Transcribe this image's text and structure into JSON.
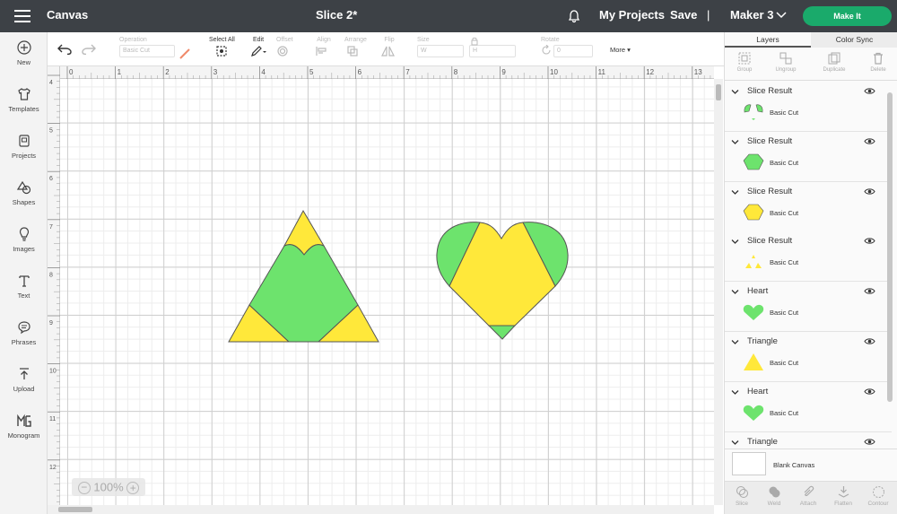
{
  "topbar": {
    "app_title": "Canvas",
    "document_title": "Slice 2*",
    "my_projects": "My Projects",
    "save": "Save",
    "separator": "|",
    "machine": "Maker 3",
    "make_it": "Make It"
  },
  "sidebar": {
    "items": [
      {
        "label": "New",
        "icon": "plus-circle-icon"
      },
      {
        "label": "Templates",
        "icon": "shirt-icon"
      },
      {
        "label": "Projects",
        "icon": "projects-icon"
      },
      {
        "label": "Shapes",
        "icon": "shapes-icon"
      },
      {
        "label": "Images",
        "icon": "lightbulb-icon"
      },
      {
        "label": "Text",
        "icon": "text-icon"
      },
      {
        "label": "Phrases",
        "icon": "speech-bubble-icon"
      },
      {
        "label": "Upload",
        "icon": "upload-icon"
      },
      {
        "label": "Monogram",
        "icon": "monogram-icon"
      }
    ]
  },
  "toolbar": {
    "operation_label": "Operation",
    "operation_value": "Basic Cut",
    "select_all": "Select All",
    "edit": "Edit",
    "offset": "Offset",
    "align": "Align",
    "arrange": "Arrange",
    "flip": "Flip",
    "size": "Size",
    "w": "W",
    "h": "H",
    "rotate": "Rotate",
    "rotate_value": "0",
    "more": "More"
  },
  "rulers": {
    "top_ticks": [
      "0",
      "1",
      "2",
      "3",
      "4",
      "5",
      "6",
      "7",
      "8",
      "9",
      "10",
      "11",
      "12",
      "13"
    ],
    "left_ticks": [
      "4",
      "5",
      "6",
      "7",
      "8",
      "9",
      "10",
      "11",
      "12"
    ]
  },
  "canvas": {
    "zoom": "100%",
    "colors": {
      "green": "#6de36d",
      "yellow": "#ffe83a"
    }
  },
  "panel": {
    "tabs": [
      "Layers",
      "Color Sync"
    ],
    "tools": [
      "Group",
      "Ungroup",
      "Duplicate",
      "Delete"
    ],
    "layers": [
      {
        "name": "Slice Result",
        "op": "Basic Cut",
        "thumb": "slice-green-pieces"
      },
      {
        "name": "Slice Result",
        "op": "Basic Cut",
        "thumb": "slice-green-octagon"
      },
      {
        "name": "Slice Result",
        "op": "Basic Cut",
        "thumb": "slice-yellow-octagon"
      },
      {
        "name": "Slice Result",
        "op": "Basic Cut",
        "thumb": "slice-yellow-triangles"
      },
      {
        "name": "Heart",
        "op": "Basic Cut",
        "thumb": "green-heart"
      },
      {
        "name": "Triangle",
        "op": "Basic Cut",
        "thumb": "yellow-triangle"
      },
      {
        "name": "Heart",
        "op": "Basic Cut",
        "thumb": "green-heart"
      },
      {
        "name": "Triangle",
        "op": "",
        "thumb": ""
      }
    ],
    "blank_canvas": "Blank Canvas",
    "bottom_tools": [
      "Slice",
      "Weld",
      "Attach",
      "Flatten",
      "Contour"
    ]
  }
}
